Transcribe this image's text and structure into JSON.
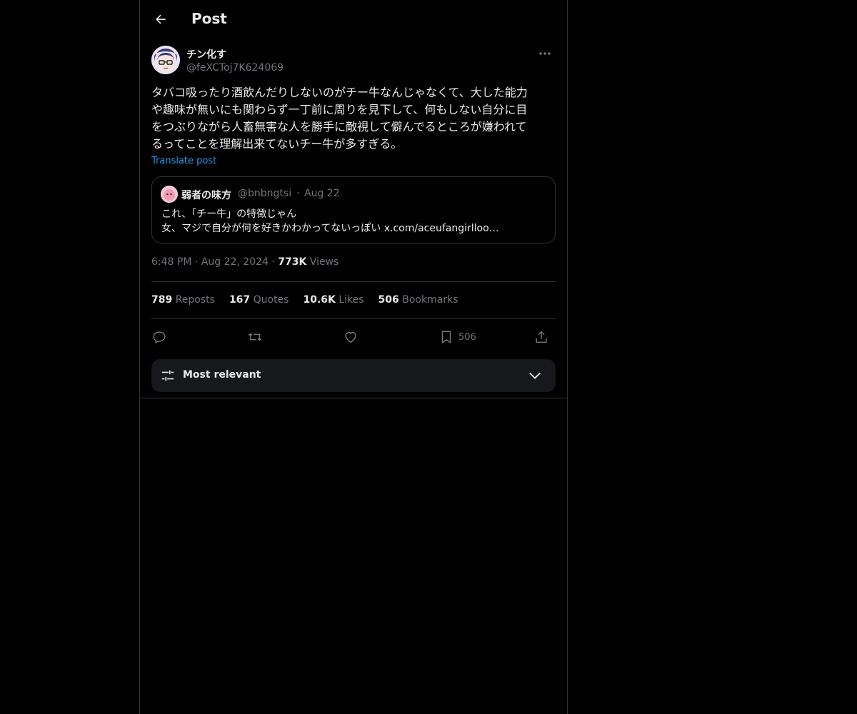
{
  "header": {
    "title": "Post"
  },
  "post": {
    "author_name": "チン化す",
    "author_handle": "@feXCToj7K624069",
    "text": "タバコ吸ったり酒飲んだりしないのがチー牛なんじゃなくて、大した能力\nや趣味が無いにも関わらず一丁前に周りを見下して、何もしない自分に目\nをつぶりながら人畜無害な人を勝手に敵視して僻んでるところが嫌われて\nるってことを理解出来てないチー牛が多すぎる。",
    "translate_label": "Translate post",
    "time": "6:48 PM",
    "date": "Aug 22, 2024",
    "views_count": "773K",
    "views_label": "Views"
  },
  "quote": {
    "name": "弱者の味方",
    "handle": "@bnbngtsi",
    "date": "Aug 22",
    "line1": "これ、「チー牛」の特徴じゃん",
    "line2": "女、マジで自分が何を好きかわかってないっぽい x.com/aceufangirlloo…"
  },
  "stats": {
    "reposts_count": "789",
    "reposts_label": "Reposts",
    "quotes_count": "167",
    "quotes_label": "Quotes",
    "likes_count": "10.6K",
    "likes_label": "Likes",
    "bookmarks_count": "506",
    "bookmarks_label": "Bookmarks"
  },
  "actions": {
    "bookmark_count": "506"
  },
  "sort": {
    "label": "Most relevant"
  },
  "icons": {
    "back": "arrow-left-icon",
    "more": "more-icon",
    "reply": "reply-icon",
    "repost": "repost-icon",
    "like": "heart-icon",
    "bookmark": "bookmark-icon",
    "share": "share-icon",
    "sort": "sliders-icon",
    "chevron": "chevron-down-icon"
  },
  "colors": {
    "link": "#1d9bf0",
    "muted": "#71767b",
    "border": "#2f3336",
    "text": "#e7e9ea"
  }
}
